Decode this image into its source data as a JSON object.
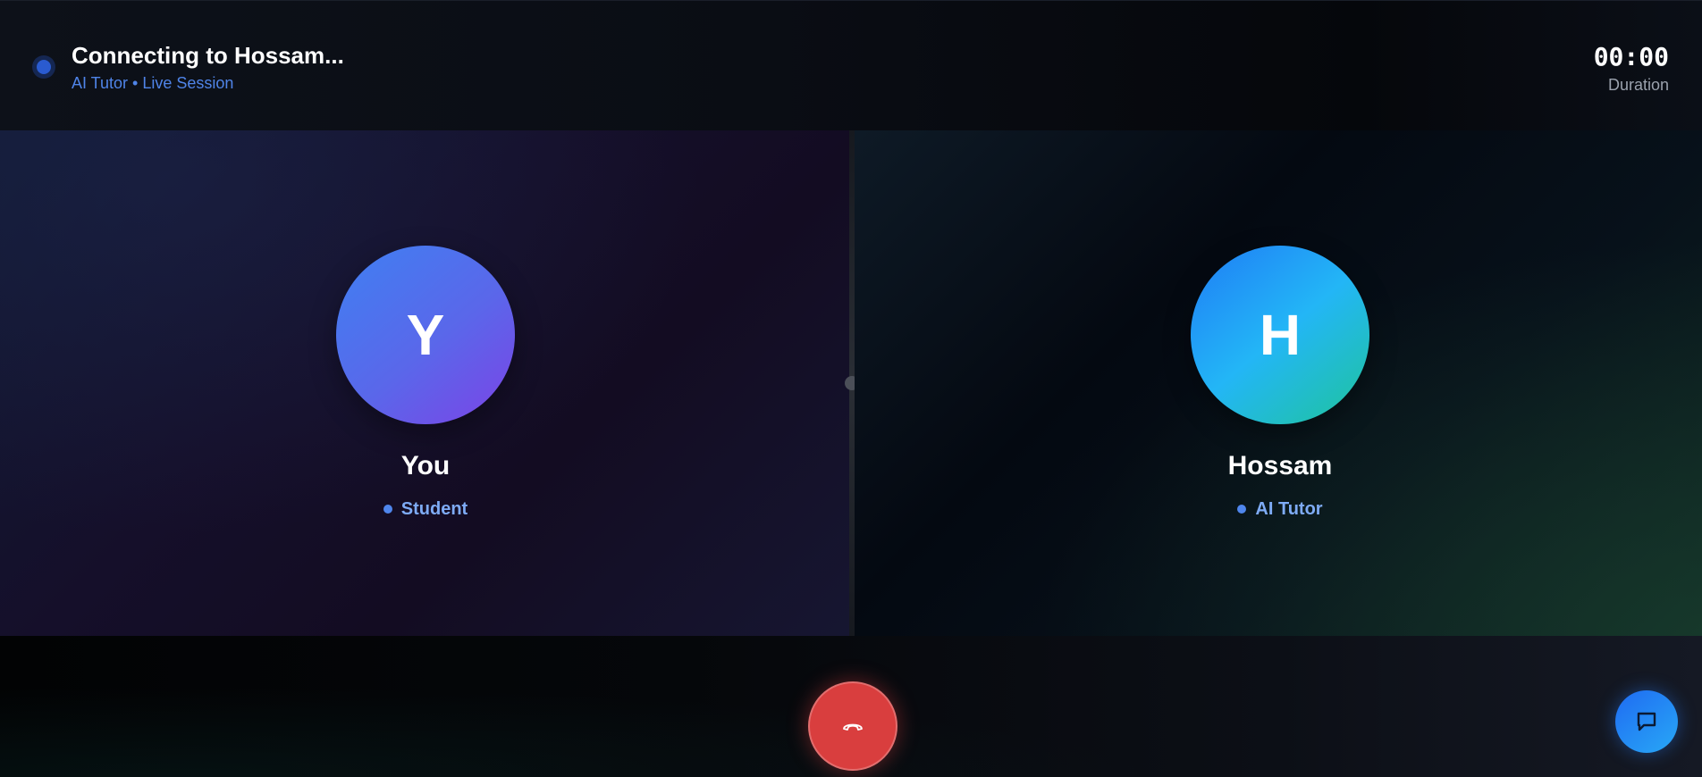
{
  "header": {
    "title": "Connecting to Hossam...",
    "subtitle": "AI Tutor • Live Session",
    "timer": "00:00",
    "timer_label": "Duration"
  },
  "participants": [
    {
      "initial": "Y",
      "name": "You",
      "role": "Student"
    },
    {
      "initial": "H",
      "name": "Hossam",
      "role": "AI Tutor"
    }
  ],
  "controls": {
    "end_call_icon": "phone-hangup-icon",
    "chat_icon": "chat-bubble-icon"
  },
  "colors": {
    "end_call": "#d93e3e",
    "accent_blue": "#4f84e8",
    "status_dot": "#2a5bd0"
  }
}
